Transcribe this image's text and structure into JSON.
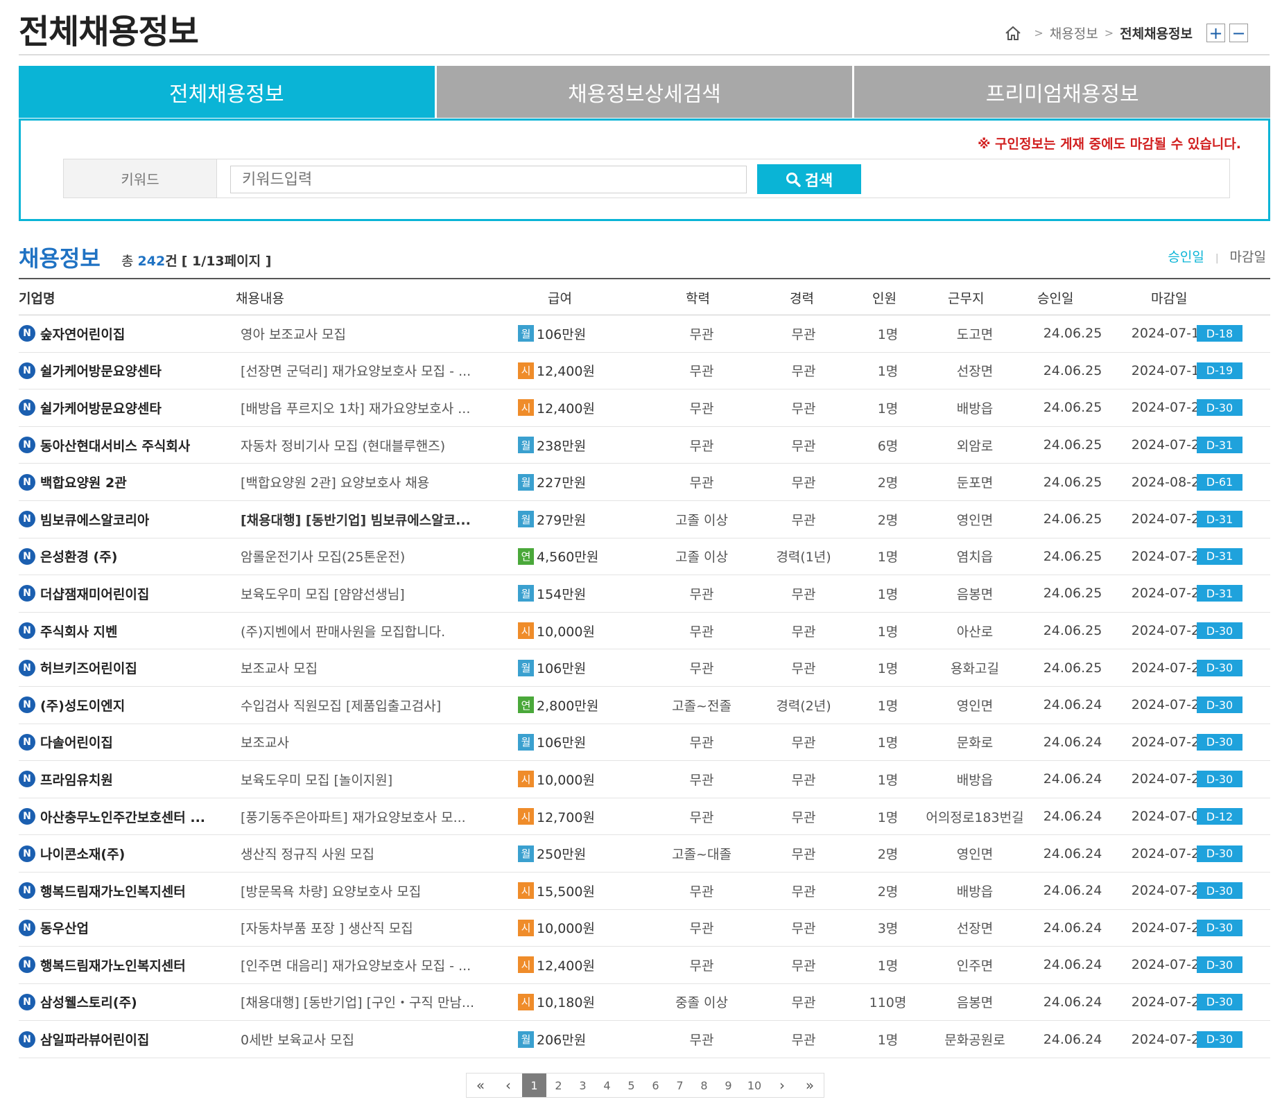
{
  "page": {
    "title": "전체채용정보"
  },
  "breadcrumb": {
    "items": [
      "채용정보",
      "전체채용정보"
    ],
    "zoom_in": "+",
    "zoom_out": "−"
  },
  "tabs": [
    {
      "label": "전체채용정보",
      "active": true
    },
    {
      "label": "채용정보상세검색",
      "active": false
    },
    {
      "label": "프리미엄채용정보",
      "active": false
    }
  ],
  "search": {
    "notice": "※ 구인정보는 게재 중에도 마감될 수 있습니다.",
    "label": "키워드",
    "placeholder": "키워드입력",
    "button": "검색"
  },
  "list": {
    "title": "채용정보",
    "count_prefix": "총",
    "count": "242",
    "count_unit": "건",
    "page_info": "[ 1/13페이지 ]",
    "sort": [
      "승인일",
      "마감일"
    ]
  },
  "columns": [
    "기업명",
    "채용내용",
    "급여",
    "학력",
    "경력",
    "인원",
    "근무지",
    "승인일",
    "마감일"
  ],
  "pay_type_colors": {
    "월": "#3aa0cf",
    "시": "#ef8c2a",
    "연": "#4aa83a"
  },
  "rows": [
    {
      "company": "숲자연어린이집",
      "content": "영아 보조교사 모집",
      "pay_type": "월",
      "pay": "106만원",
      "edu": "무관",
      "exp": "무관",
      "num": "1명",
      "loc": "도고면",
      "approved": "24.06.25",
      "deadline": "2024-07-12",
      "dday": "D-18"
    },
    {
      "company": "쉴가케어방문요양센타",
      "content": "[선장면 군덕리] 재가요양보호사 모집 - ...",
      "pay_type": "시",
      "pay": "12,400원",
      "edu": "무관",
      "exp": "무관",
      "num": "1명",
      "loc": "선장면",
      "approved": "24.06.25",
      "deadline": "2024-07-13",
      "dday": "D-19"
    },
    {
      "company": "쉴가케어방문요양센타",
      "content": "[배방읍 푸르지오 1차] 재가요양보호사 ...",
      "pay_type": "시",
      "pay": "12,400원",
      "edu": "무관",
      "exp": "무관",
      "num": "1명",
      "loc": "배방읍",
      "approved": "24.06.25",
      "deadline": "2024-07-24",
      "dday": "D-30"
    },
    {
      "company": "동아산현대서비스 주식회사",
      "content": "자동차 정비기사 모집 (현대블루핸즈)",
      "pay_type": "월",
      "pay": "238만원",
      "edu": "무관",
      "exp": "무관",
      "num": "6명",
      "loc": "외암로",
      "approved": "24.06.25",
      "deadline": "2024-07-25",
      "dday": "D-31"
    },
    {
      "company": "백합요양원 2관",
      "content": "[백합요양원 2관] 요양보호사 채용",
      "pay_type": "월",
      "pay": "227만원",
      "edu": "무관",
      "exp": "무관",
      "num": "2명",
      "loc": "둔포면",
      "approved": "24.06.25",
      "deadline": "2024-08-24",
      "dday": "D-61"
    },
    {
      "company": "빔보큐에스알코리아",
      "content": "[채용대행] [동반기업] 빔보큐에스알코...",
      "bold": true,
      "pay_type": "월",
      "pay": "279만원",
      "edu": "고졸 이상",
      "exp": "무관",
      "num": "2명",
      "loc": "영인면",
      "approved": "24.06.25",
      "deadline": "2024-07-25",
      "dday": "D-31"
    },
    {
      "company": "은성환경 (주)",
      "content": "암롤운전기사 모집(25톤운전)",
      "pay_type": "연",
      "pay": "4,560만원",
      "edu": "고졸 이상",
      "exp": "경력(1년)",
      "num": "1명",
      "loc": "염치읍",
      "approved": "24.06.25",
      "deadline": "2024-07-25",
      "dday": "D-31"
    },
    {
      "company": "더샵잼재미어린이집",
      "content": "보육도우미 모집 [얌얌선생님]",
      "pay_type": "월",
      "pay": "154만원",
      "edu": "무관",
      "exp": "무관",
      "num": "1명",
      "loc": "음봉면",
      "approved": "24.06.25",
      "deadline": "2024-07-25",
      "dday": "D-31"
    },
    {
      "company": "주식회사 지벤",
      "content": "(주)지벤에서 판매사원을 모집합니다.",
      "pay_type": "시",
      "pay": "10,000원",
      "edu": "무관",
      "exp": "무관",
      "num": "1명",
      "loc": "아산로",
      "approved": "24.06.25",
      "deadline": "2024-07-24",
      "dday": "D-30"
    },
    {
      "company": "허브키즈어린이집",
      "content": "보조교사 모집",
      "pay_type": "월",
      "pay": "106만원",
      "edu": "무관",
      "exp": "무관",
      "num": "1명",
      "loc": "용화고길",
      "approved": "24.06.25",
      "deadline": "2024-07-24",
      "dday": "D-30"
    },
    {
      "company": "(주)성도이엔지",
      "content": "수입검사 직원모집 [제품입출고검사]",
      "pay_type": "연",
      "pay": "2,800만원",
      "edu": "고졸~전졸",
      "exp": "경력(2년)",
      "num": "1명",
      "loc": "영인면",
      "approved": "24.06.24",
      "deadline": "2024-07-24",
      "dday": "D-30"
    },
    {
      "company": "다솔어린이집",
      "content": "보조교사",
      "pay_type": "월",
      "pay": "106만원",
      "edu": "무관",
      "exp": "무관",
      "num": "1명",
      "loc": "문화로",
      "approved": "24.06.24",
      "deadline": "2024-07-24",
      "dday": "D-30"
    },
    {
      "company": "프라임유치원",
      "content": "보육도우미 모집 [놀이지원]",
      "pay_type": "시",
      "pay": "10,000원",
      "edu": "무관",
      "exp": "무관",
      "num": "1명",
      "loc": "배방읍",
      "approved": "24.06.24",
      "deadline": "2024-07-24",
      "dday": "D-30"
    },
    {
      "company": "아산충무노인주간보호센터 ...",
      "content": "[풍기동주은아파트] 재가요양보호사 모...",
      "pay_type": "시",
      "pay": "12,700원",
      "edu": "무관",
      "exp": "무관",
      "num": "1명",
      "loc": "어의정로183번길",
      "approved": "24.06.24",
      "deadline": "2024-07-06",
      "dday": "D-12"
    },
    {
      "company": "나이콘소재(주)",
      "content": "생산직 정규직 사원 모집",
      "pay_type": "월",
      "pay": "250만원",
      "edu": "고졸~대졸",
      "exp": "무관",
      "num": "2명",
      "loc": "영인면",
      "approved": "24.06.24",
      "deadline": "2024-07-24",
      "dday": "D-30"
    },
    {
      "company": "행복드림재가노인복지센터",
      "content": "[방문목욕 차량] 요양보호사 모집",
      "pay_type": "시",
      "pay": "15,500원",
      "edu": "무관",
      "exp": "무관",
      "num": "2명",
      "loc": "배방읍",
      "approved": "24.06.24",
      "deadline": "2024-07-24",
      "dday": "D-30"
    },
    {
      "company": "동우산업",
      "content": "[자동차부품 포장 ] 생산직 모집",
      "pay_type": "시",
      "pay": "10,000원",
      "edu": "무관",
      "exp": "무관",
      "num": "3명",
      "loc": "선장면",
      "approved": "24.06.24",
      "deadline": "2024-07-24",
      "dday": "D-30"
    },
    {
      "company": "행복드림재가노인복지센터",
      "content": "[인주면 대음리] 재가요양보호사 모집 - ...",
      "pay_type": "시",
      "pay": "12,400원",
      "edu": "무관",
      "exp": "무관",
      "num": "1명",
      "loc": "인주면",
      "approved": "24.06.24",
      "deadline": "2024-07-24",
      "dday": "D-30"
    },
    {
      "company": "삼성웰스토리(주)",
      "content": "[채용대행] [동반기업] [구인・구직 만남...",
      "pay_type": "시",
      "pay": "10,180원",
      "edu": "중졸 이상",
      "exp": "무관",
      "num": "110명",
      "loc": "음봉면",
      "approved": "24.06.24",
      "deadline": "2024-07-24",
      "dday": "D-30"
    },
    {
      "company": "삼일파라뷰어린이집",
      "content": "0세반 보육교사 모집",
      "pay_type": "월",
      "pay": "206만원",
      "edu": "무관",
      "exp": "무관",
      "num": "1명",
      "loc": "문화공원로",
      "approved": "24.06.24",
      "deadline": "2024-07-24",
      "dday": "D-30"
    }
  ],
  "pagination": {
    "first": "«",
    "prev": "‹",
    "next": "›",
    "last": "»",
    "pages": [
      "1",
      "2",
      "3",
      "4",
      "5",
      "6",
      "7",
      "8",
      "9",
      "10"
    ],
    "current": "1"
  }
}
